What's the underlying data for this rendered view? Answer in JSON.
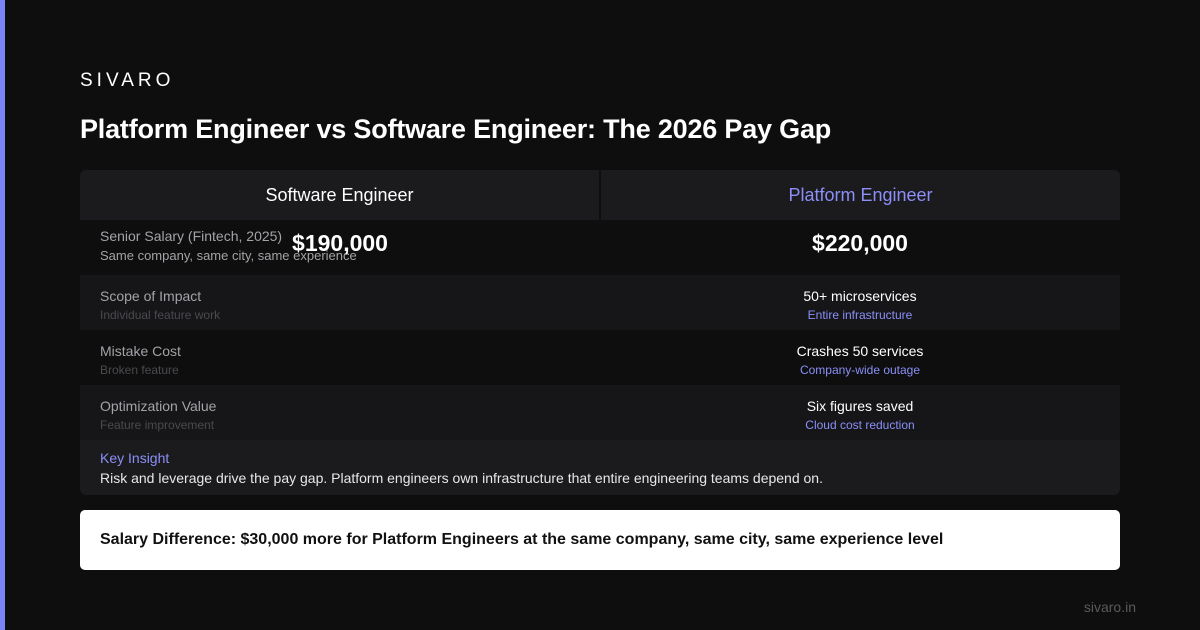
{
  "brand": "SIVARO",
  "title": "Platform Engineer vs Software Engineer: The 2026 Pay Gap",
  "columns": {
    "left": "Software Engineer",
    "right": "Platform Engineer"
  },
  "salary_row": {
    "label": "Senior Salary (Fintech, 2025)",
    "sublabel": "Same company, same city, same experience",
    "left_value": "$190,000",
    "right_value": "$220,000"
  },
  "rows": [
    {
      "label": "Scope of Impact",
      "left_sub": "Individual feature work",
      "right_main": "50+ microservices",
      "right_sub": "Entire infrastructure"
    },
    {
      "label": "Mistake Cost",
      "left_sub": "Broken feature",
      "right_main": "Crashes 50 services",
      "right_sub": "Company-wide outage"
    },
    {
      "label": "Optimization Value",
      "left_sub": "Feature improvement",
      "right_main": "Six figures saved",
      "right_sub": "Cloud cost reduction"
    }
  ],
  "insight": {
    "title": "Key Insight",
    "text": "Risk and leverage drive the pay gap. Platform engineers own infrastructure that entire engineering teams depend on."
  },
  "callout": "Salary Difference: $30,000 more for Platform Engineers at the same company, same city, same experience level",
  "footer": "sivaro.in",
  "colors": {
    "background": "#0e0e0e",
    "accent": "#7c83f7",
    "accent_text": "#8b8ff7",
    "panel": "#1b1b1e",
    "callout_bg": "#ffffff"
  }
}
